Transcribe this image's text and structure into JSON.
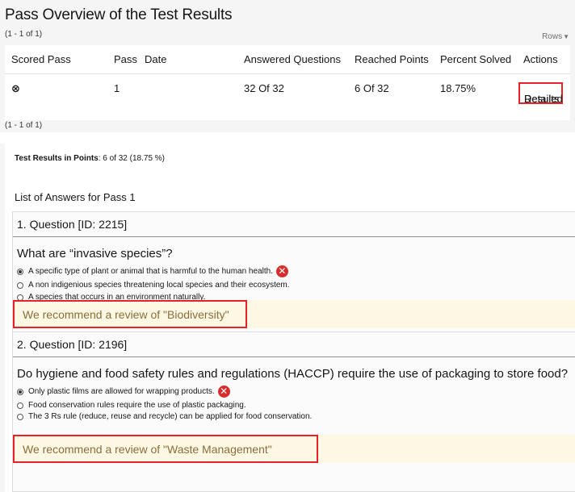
{
  "overview": {
    "title": "Pass Overview of the Test Results",
    "range_top": "(1 - 1 of 1)",
    "range_bottom": "(1 - 1 of 1)",
    "rows_label": "Rows",
    "columns": {
      "scored_pass": "Scored Pass",
      "pass": "Pass",
      "date": "Date",
      "answered": "Answered Questions",
      "reached": "Reached Points",
      "percent": "Percent Solved",
      "actions": "Actions"
    },
    "row": {
      "scored_mark": "⊗",
      "pass": "1",
      "date": "",
      "answered": "32 Of 32",
      "reached": "6 Of 32",
      "percent": "18.75%",
      "action_line1": "Detailed",
      "action_line2": "Results"
    }
  },
  "results": {
    "points_label": "Test Results in Points",
    "points_value": ": 6 of 32 (18.75 %)",
    "list_heading": "List of Answers for Pass 1",
    "questions": [
      {
        "header": "1. Question [ID: 2215]",
        "text": "What are “invasive species”?",
        "options": [
          "A specific type of plant or animal that is harmful to the human health.",
          "A non indigenious species threatening local species and their ecosystem.",
          "A species that occurs in an environment naturally."
        ],
        "recommendation": "We recommend a review of \"Biodiversity\""
      },
      {
        "header": "2. Question [ID: 2196]",
        "text": "Do hygiene and food safety rules and regulations (HACCP) require the use of packaging to store food?",
        "options": [
          "Only plastic films are allowed for wrapping products.",
          "Food conservation rules require the use of plastic packaging.",
          "The 3 Rs rule (reduce, reuse and recycle) can be applied for food conservation."
        ],
        "recommendation": "We recommend a review of \"Waste Management\""
      }
    ]
  },
  "colors": {
    "panel_bg": "#f5f5f5",
    "link": "#557b2e",
    "highlight_border": "#e8202a",
    "recommend_bg": "#fcf8e3",
    "recommend_text": "#8a6d3b",
    "wrong_icon": "#d82d2d"
  },
  "icons": {
    "scored_fail": "circled-x-icon",
    "wrong_answer": "red-x-circle-icon",
    "rows_caret": "caret-down-icon"
  }
}
